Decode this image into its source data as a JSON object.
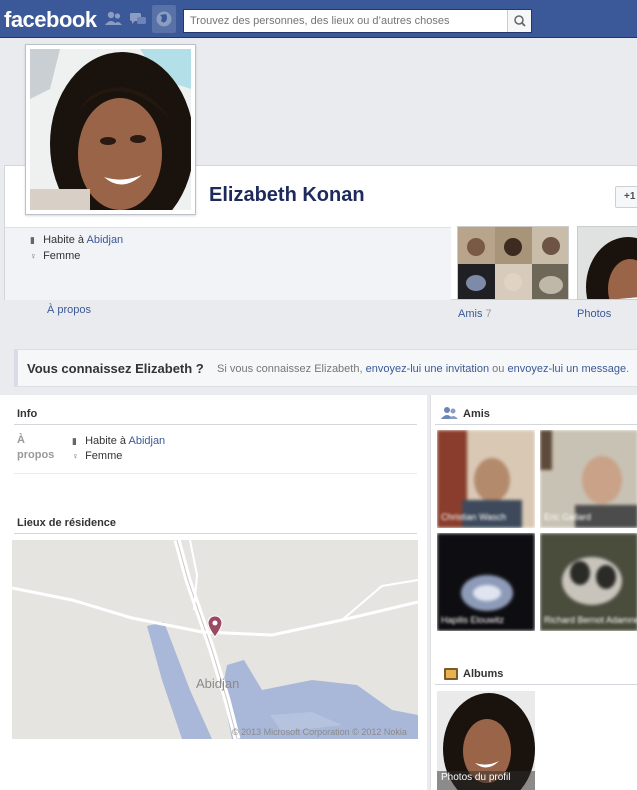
{
  "topbar": {
    "logo": "facebook",
    "search_placeholder": "Trouvez des personnes, des lieux ou d’autres choses"
  },
  "profile": {
    "name": "Elizabeth Konan",
    "add_friend_label": "+1",
    "facts": [
      {
        "prefix": "Habite à ",
        "link": "Abidjan",
        "icon": "house-icon"
      },
      {
        "prefix": "Femme",
        "link": "",
        "icon": "gender-icon"
      }
    ],
    "about_link": "À propos",
    "friends_label": "Amis",
    "friends_count": "7",
    "photos_label": "Photos"
  },
  "know_bar": {
    "title": "Vous connaissez Elizabeth ?",
    "text_start": "Si vous connaissez Elizabeth, ",
    "link_invite": "envoyez-lui une invitation",
    "text_mid": " ou ",
    "link_message": "envoyez-lui un message",
    "text_end": "."
  },
  "info": {
    "title": "Info",
    "label_line1": "À",
    "label_line2": "propos",
    "facts": [
      {
        "prefix": "Habite à ",
        "link": "Abidjan"
      },
      {
        "prefix": "Femme",
        "link": ""
      }
    ]
  },
  "places": {
    "title": "Lieux de résidence",
    "city": "Abidjan",
    "credit": "© 2013 Microsoft Corporation © 2012 Nokia"
  },
  "friends_box": {
    "title": "Amis",
    "friends": [
      {
        "name": "Christian Wasch"
      },
      {
        "name": "Eric Gallard"
      },
      {
        "name": "Hapilis Elouwitz"
      },
      {
        "name": "Richard Bernot Adamne"
      }
    ]
  },
  "albums": {
    "title": "Albums",
    "album_label": "Photos du profil"
  },
  "colors": {
    "brand": "#3b5998",
    "link": "#3b5998",
    "map_water": "#a9b8d8",
    "map_pin": "#9b4a63"
  }
}
